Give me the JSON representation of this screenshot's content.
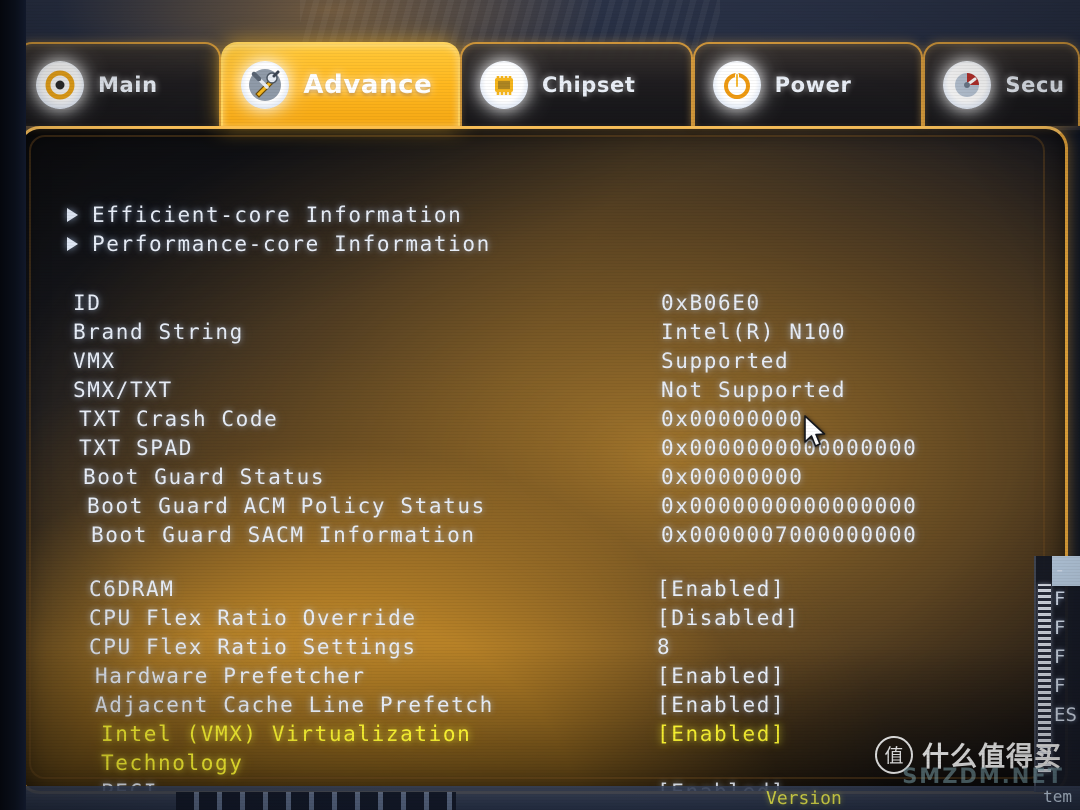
{
  "tabs": [
    {
      "label": "Main",
      "icon": "target-icon",
      "active": false
    },
    {
      "label": "Advance",
      "icon": "tools-icon",
      "active": true
    },
    {
      "label": "Chipset",
      "icon": "chip-icon",
      "active": false
    },
    {
      "label": "Power",
      "icon": "power-icon",
      "active": false
    },
    {
      "label": "Secu",
      "icon": "security-icon",
      "active": false
    }
  ],
  "submenus": [
    {
      "label": "Efficient-core Information"
    },
    {
      "label": "Performance-core Information"
    }
  ],
  "cpu_info": [
    {
      "label": "ID",
      "value": "0xB06E0"
    },
    {
      "label": "Brand String",
      "value": "Intel(R) N100"
    },
    {
      "label": "VMX",
      "value": "Supported"
    },
    {
      "label": "SMX/TXT",
      "value": "Not Supported"
    },
    {
      "label": "TXT Crash Code",
      "value": "0x00000000"
    },
    {
      "label": "TXT SPAD",
      "value": "0x0000000000000000"
    },
    {
      "label": "Boot Guard Status",
      "value": "0x00000000"
    },
    {
      "label": "Boot Guard ACM Policy Status",
      "value": "0x0000000000000000"
    },
    {
      "label": "Boot Guard SACM Information",
      "value": "0x0000007000000000"
    }
  ],
  "settings": [
    {
      "label": "C6DRAM",
      "value": "[Enabled]",
      "highlighted": false
    },
    {
      "label": "CPU Flex Ratio Override",
      "value": "[Disabled]",
      "highlighted": false
    },
    {
      "label": "CPU Flex Ratio Settings",
      "value": "8",
      "highlighted": false
    },
    {
      "label": "Hardware Prefetcher",
      "value": "[Enabled]",
      "highlighted": false
    },
    {
      "label": "Adjacent Cache Line Prefetch",
      "value": "[Enabled]",
      "highlighted": false
    },
    {
      "label": "Intel (VMX) Virtualization",
      "value": "[Enabled]",
      "highlighted": true
    },
    {
      "label": "Technology",
      "value": "",
      "highlighted": true
    },
    {
      "label": "PECI",
      "value": "[Enabled]",
      "highlighted": false
    }
  ],
  "hotkey_rail": [
    "",
    "-",
    "F",
    "F",
    "F",
    "F",
    "ES"
  ],
  "bottom_bar": {
    "center_text": "Version",
    "right_text": "tem"
  },
  "watermark": {
    "badge": "值",
    "text": "什么值得买",
    "site": "SMZDM.NET"
  },
  "colors": {
    "accent": "#ffb81f",
    "panel_border": "#f0ac3c",
    "text": "#e7edf7",
    "highlight": "#fdf732"
  },
  "cursor": {
    "name": "arrow-pointer"
  }
}
